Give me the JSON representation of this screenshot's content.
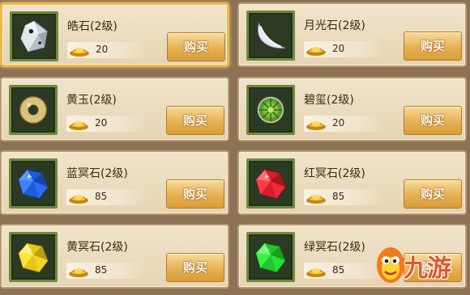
{
  "shop": {
    "items": [
      {
        "name": "皓石",
        "level": "(2级)",
        "price": "20",
        "buy_label": "购买",
        "icon": "white-crystal-icon"
      },
      {
        "name": "月光石",
        "level": "(2级)",
        "price": "20",
        "buy_label": "购买",
        "icon": "moonstone-crescent-icon"
      },
      {
        "name": "黄玉",
        "level": "(2级)",
        "price": "20",
        "buy_label": "购买",
        "icon": "yellow-jade-ring-icon"
      },
      {
        "name": "碧玺",
        "level": "(2级)",
        "price": "20",
        "buy_label": "购买",
        "icon": "green-tourmaline-icon"
      },
      {
        "name": "蓝冥石",
        "level": "(2级)",
        "price": "85",
        "buy_label": "购买",
        "icon": "blue-gem-icon"
      },
      {
        "name": "红冥石",
        "level": "(2级)",
        "price": "85",
        "buy_label": "购买",
        "icon": "red-gem-icon"
      },
      {
        "name": "黄冥石",
        "level": "(2级)",
        "price": "85",
        "buy_label": "购买",
        "icon": "yellow-gem-icon"
      },
      {
        "name": "绿冥石",
        "level": "(2级)",
        "price": "85",
        "buy_label": "购买",
        "icon": "green-gem-icon"
      }
    ]
  },
  "watermark": {
    "text": "九游"
  },
  "colors": {
    "accent": "#e9b94a",
    "button": "#e6b154",
    "frame": "#6e8a3c"
  }
}
